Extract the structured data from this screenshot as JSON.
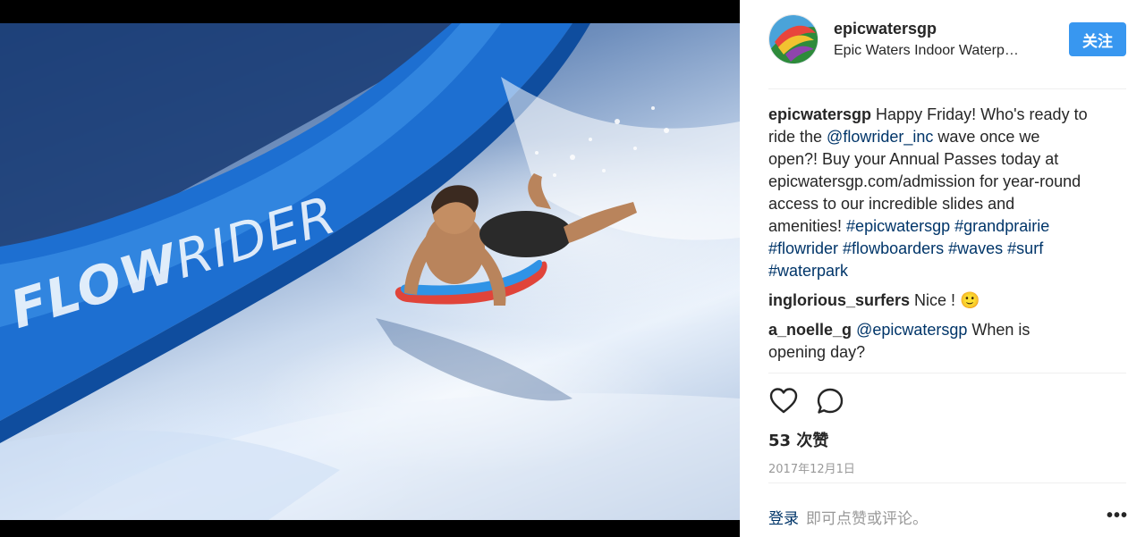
{
  "post": {
    "photo_brand_bold": "FLOW",
    "photo_brand_thin": "RIDER",
    "photo_alt": ""
  },
  "header": {
    "username": "epicwatersgp",
    "location": "Epic Waters Indoor Waterp…",
    "follow_label": "关注"
  },
  "caption": {
    "user": "epicwatersgp",
    "text_1": " Happy Friday! Who's ready to ride the ",
    "mention": "@flowrider_inc",
    "text_2": " wave once we open?! Buy your Annual Passes today at epicwatersgp.com/admission for year-round access to our incredible slides and amenities! ",
    "hashtags": [
      "#epicwatersgp",
      "#grandprairie",
      "#flowrider",
      "#flowboarders",
      "#waves",
      "#surf",
      "#waterpark"
    ]
  },
  "comments": [
    {
      "user": "inglorious_surfers",
      "text": " Nice ! 🙂"
    },
    {
      "user": "a_noelle_g",
      "mention": "@epicwatersgp",
      "text": " When is opening day?"
    }
  ],
  "actions": {
    "like_icon": "heart-icon",
    "comment_icon": "comment-bubble-icon"
  },
  "likes_label": "53 次赞",
  "date": "2017年12月1日",
  "footer": {
    "login_label": "登录",
    "login_hint": "即可点赞或评论。",
    "more_label": "•••"
  },
  "colors": {
    "follow_button": "#3897f0",
    "link": "#003569",
    "muted": "#999999"
  }
}
